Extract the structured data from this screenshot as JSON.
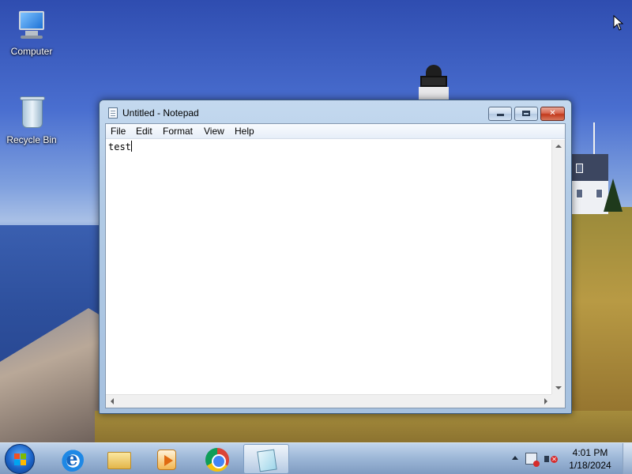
{
  "desktop": {
    "icons": [
      {
        "label": "Computer"
      },
      {
        "label": "Recycle Bin"
      }
    ]
  },
  "notepad": {
    "title": "Untitled - Notepad",
    "menu": [
      "File",
      "Edit",
      "Format",
      "View",
      "Help"
    ],
    "content": "test"
  },
  "taskbar": {
    "pinned": [
      {
        "icon": "internet-explorer-icon"
      },
      {
        "icon": "file-explorer-icon"
      },
      {
        "icon": "media-player-icon"
      },
      {
        "icon": "chrome-icon"
      },
      {
        "icon": "notepad-icon",
        "active": true
      }
    ],
    "clock": {
      "time": "4:01 PM",
      "date": "1/18/2024"
    }
  },
  "colors": {
    "close_button": "#c2391c",
    "titlebar": "#b2cbe6"
  }
}
